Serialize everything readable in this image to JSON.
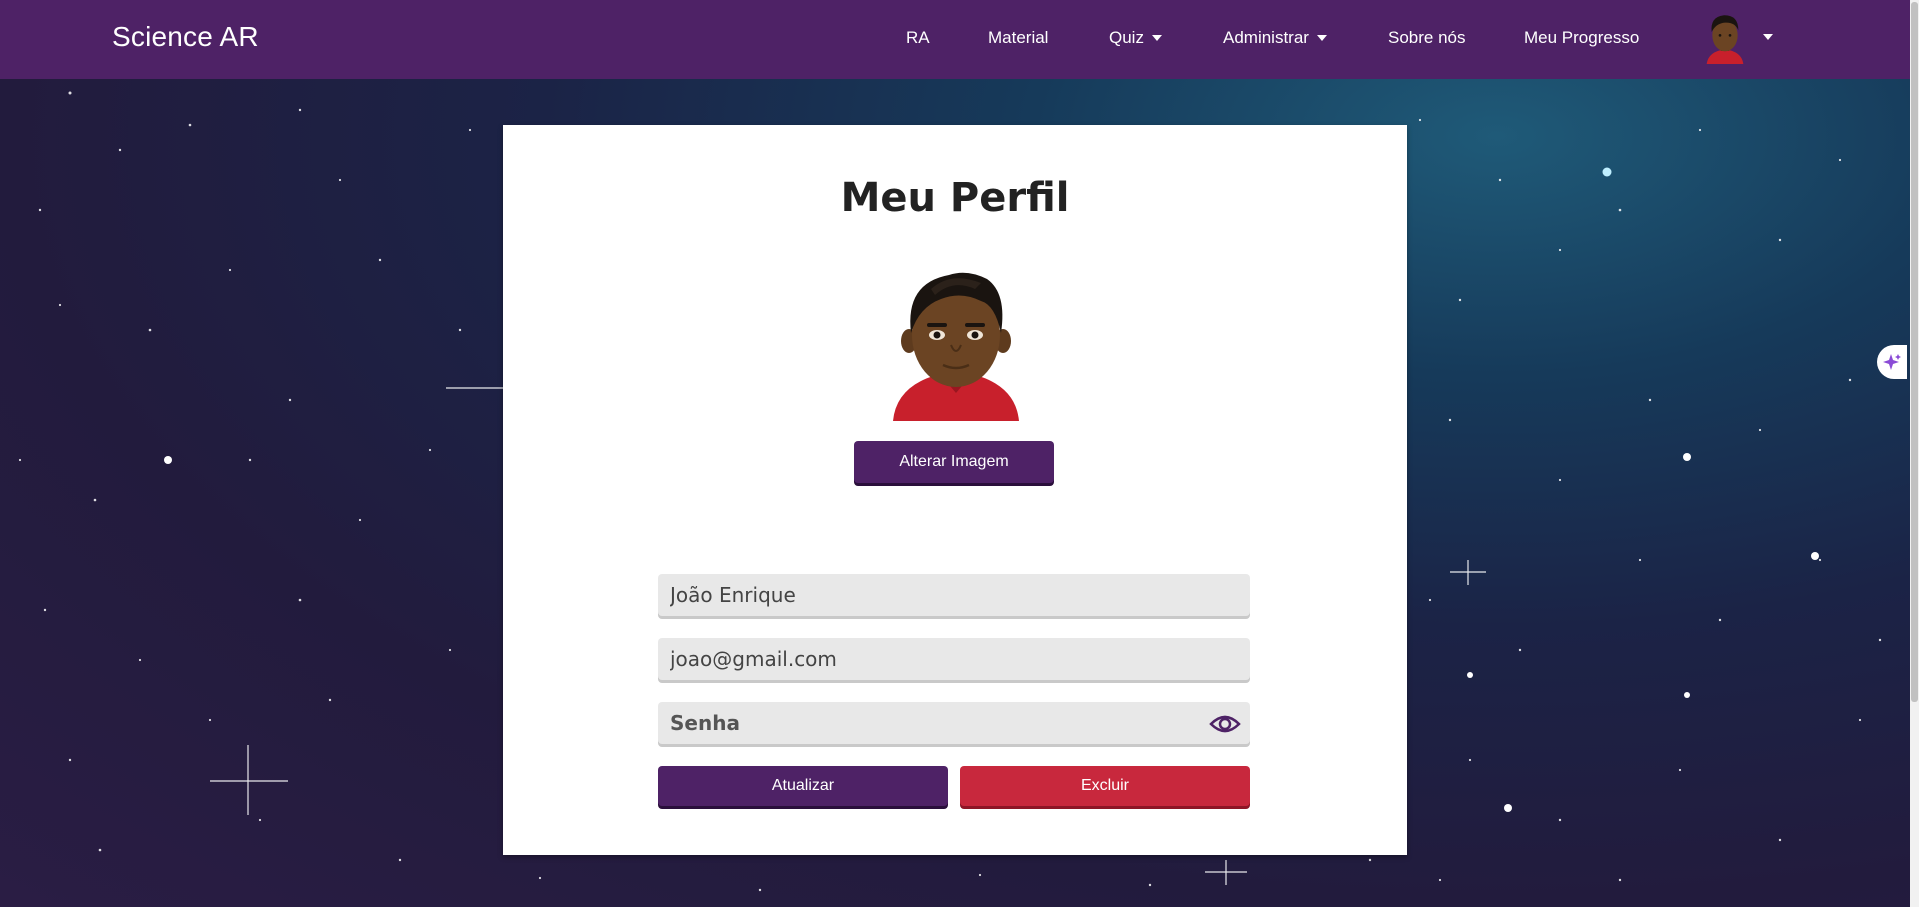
{
  "app": {
    "brand": "Science AR"
  },
  "nav": {
    "items": [
      {
        "label": "RA",
        "dropdown": false
      },
      {
        "label": "Material",
        "dropdown": false
      },
      {
        "label": "Quiz",
        "dropdown": true
      },
      {
        "label": "Administrar",
        "dropdown": true
      },
      {
        "label": "Sobre nós",
        "dropdown": false
      },
      {
        "label": "Meu Progresso",
        "dropdown": false
      }
    ]
  },
  "profile": {
    "title": "Meu Perfil",
    "change_image_label": "Alterar Imagem",
    "name_value": "João Enrique",
    "email_value": "joao@gmail.com",
    "password_placeholder": "Senha",
    "update_label": "Atualizar",
    "delete_label": "Excluir"
  },
  "colors": {
    "primary": "#4e2266",
    "danger": "#c8283d",
    "field_bg": "#e8e8e8"
  },
  "icons": {
    "password_toggle": "eye-icon",
    "side_tab": "sparkle-icon",
    "avatar": "cartoon-avatar"
  }
}
